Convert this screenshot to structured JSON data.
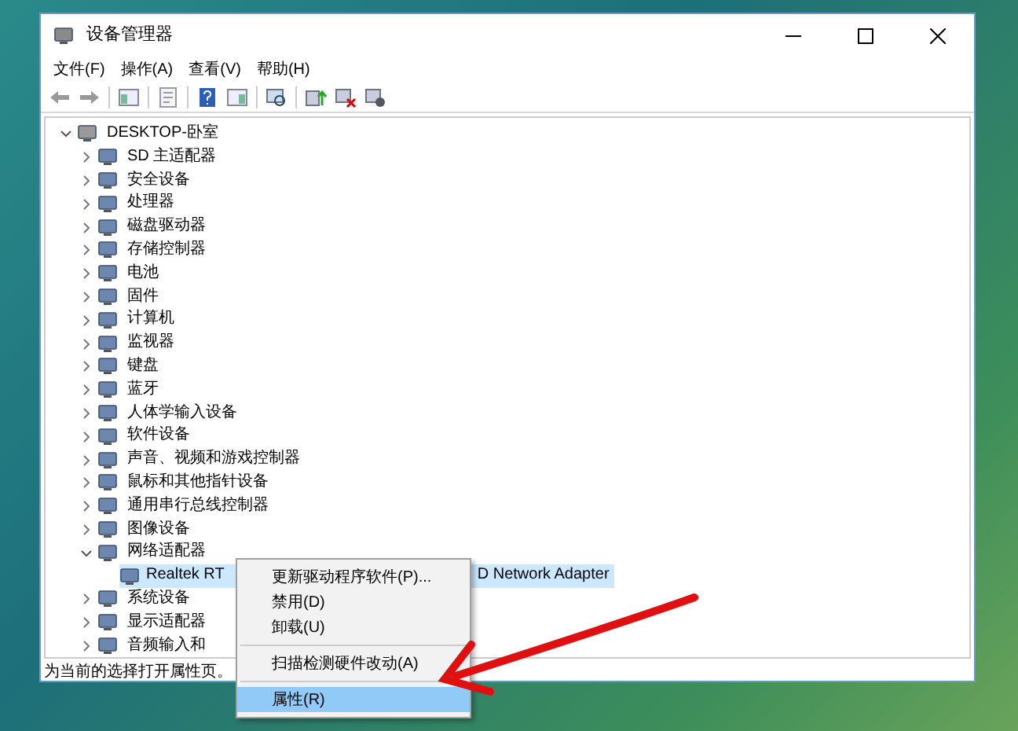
{
  "window": {
    "title": "设备管理器"
  },
  "menu": [
    "文件(F)",
    "操作(A)",
    "查看(V)",
    "帮助(H)"
  ],
  "tree": {
    "label": "DESKTOP-卧室",
    "expanded": true,
    "selected": false,
    "children": [
      {
        "label": "SD 主适配器",
        "expanded": false,
        "selected": false
      },
      {
        "label": "安全设备",
        "expanded": false,
        "selected": false
      },
      {
        "label": "处理器",
        "expanded": false,
        "selected": false
      },
      {
        "label": "磁盘驱动器",
        "expanded": false,
        "selected": false
      },
      {
        "label": "存储控制器",
        "expanded": false,
        "selected": false
      },
      {
        "label": "电池",
        "expanded": false,
        "selected": false
      },
      {
        "label": "固件",
        "expanded": false,
        "selected": false
      },
      {
        "label": "计算机",
        "expanded": false,
        "selected": false
      },
      {
        "label": "监视器",
        "expanded": false,
        "selected": false
      },
      {
        "label": "键盘",
        "expanded": false,
        "selected": false
      },
      {
        "label": "蓝牙",
        "expanded": false,
        "selected": false
      },
      {
        "label": "人体学输入设备",
        "expanded": false,
        "selected": false
      },
      {
        "label": "软件设备",
        "expanded": false,
        "selected": false
      },
      {
        "label": "声音、视频和游戏控制器",
        "expanded": false,
        "selected": false
      },
      {
        "label": "鼠标和其他指针设备",
        "expanded": false,
        "selected": false
      },
      {
        "label": "通用串行总线控制器",
        "expanded": false,
        "selected": false
      },
      {
        "label": "图像设备",
        "expanded": false,
        "selected": false
      },
      {
        "label": "网络适配器",
        "expanded": true,
        "selected": false,
        "children": [
          {
            "label_parts": [
              "Realtek RT",
              "D Network Adapter"
            ],
            "selected": true
          }
        ]
      },
      {
        "label": "系统设备",
        "expanded": false,
        "selected": false
      },
      {
        "label": "显示适配器",
        "expanded": false,
        "selected": false
      },
      {
        "label": "音频输入和",
        "expanded": false,
        "selected": false
      }
    ]
  },
  "status_bar": "为当前的选择打开属性页。",
  "context_menu": [
    {
      "kind": "item",
      "label": "更新驱动程序软件(P)...",
      "selected": false
    },
    {
      "kind": "item",
      "label": "禁用(D)",
      "selected": false
    },
    {
      "kind": "item",
      "label": "卸载(U)",
      "selected": false
    },
    {
      "kind": "separator"
    },
    {
      "kind": "item",
      "label": "扫描检测硬件改动(A)",
      "selected": false
    },
    {
      "kind": "separator"
    },
    {
      "kind": "item",
      "label": "属性(R)",
      "selected": true
    }
  ]
}
